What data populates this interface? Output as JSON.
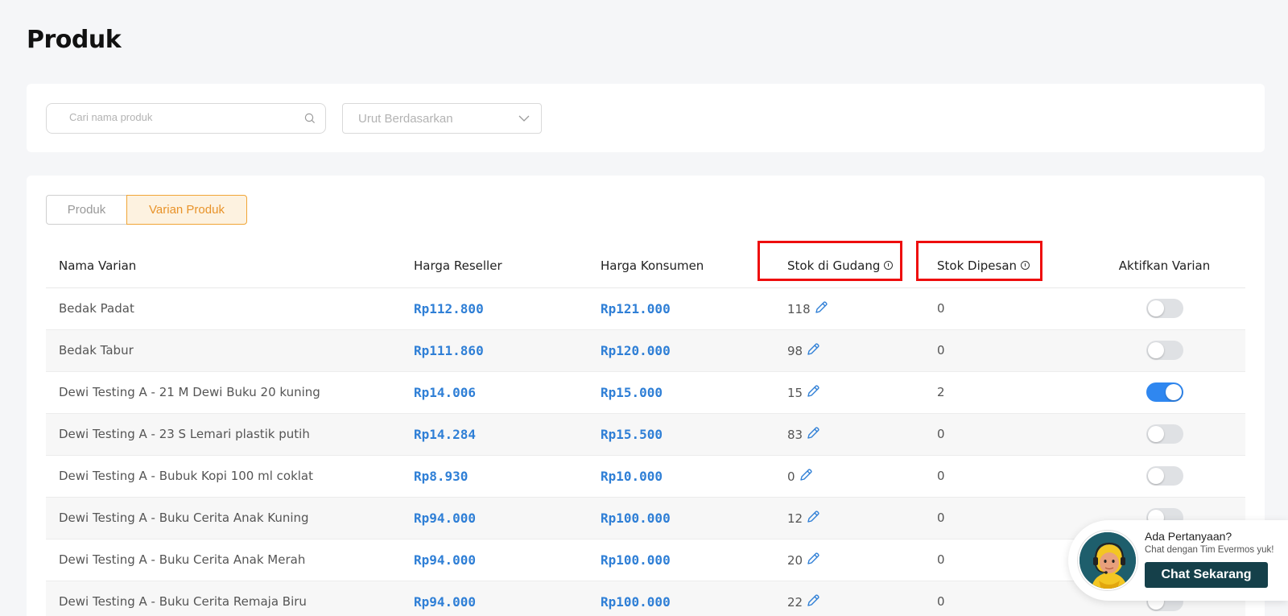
{
  "page": {
    "title": "Produk"
  },
  "filters": {
    "search_placeholder": "Cari nama produk",
    "sort_label": "Urut Berdasarkan"
  },
  "tabs": [
    {
      "label": "Produk",
      "active": false
    },
    {
      "label": "Varian Produk",
      "active": true
    }
  ],
  "table": {
    "columns": [
      "Nama Varian",
      "Harga Reseller",
      "Harga Konsumen",
      "Stok di Gudang",
      "Stok Dipesan",
      "Aktifkan Varian"
    ],
    "highlighted_columns": [
      "Stok di Gudang",
      "Stok Dipesan"
    ],
    "rows": [
      {
        "name": "Bedak Padat",
        "reseller": "Rp112.800",
        "consumer": "Rp121.000",
        "stock": "118",
        "ordered": "0",
        "active": false
      },
      {
        "name": "Bedak Tabur",
        "reseller": "Rp111.860",
        "consumer": "Rp120.000",
        "stock": "98",
        "ordered": "0",
        "active": false
      },
      {
        "name": "Dewi Testing A - 21 M Dewi Buku 20 kuning",
        "reseller": "Rp14.006",
        "consumer": "Rp15.000",
        "stock": "15",
        "ordered": "2",
        "active": true
      },
      {
        "name": "Dewi Testing A - 23 S Lemari plastik putih",
        "reseller": "Rp14.284",
        "consumer": "Rp15.500",
        "stock": "83",
        "ordered": "0",
        "active": false
      },
      {
        "name": "Dewi Testing A - Bubuk Kopi 100 ml coklat",
        "reseller": "Rp8.930",
        "consumer": "Rp10.000",
        "stock": "0",
        "ordered": "0",
        "active": false
      },
      {
        "name": "Dewi Testing A - Buku Cerita Anak Kuning",
        "reseller": "Rp94.000",
        "consumer": "Rp100.000",
        "stock": "12",
        "ordered": "0",
        "active": false
      },
      {
        "name": "Dewi Testing A - Buku Cerita Anak Merah",
        "reseller": "Rp94.000",
        "consumer": "Rp100.000",
        "stock": "20",
        "ordered": "0",
        "active": false
      },
      {
        "name": "Dewi Testing A - Buku Cerita Remaja Biru",
        "reseller": "Rp94.000",
        "consumer": "Rp100.000",
        "stock": "22",
        "ordered": "0",
        "active": false
      }
    ]
  },
  "chat": {
    "title": "Ada Pertanyaan?",
    "subtitle": "Chat dengan Tim Evermos yuk!",
    "button": "Chat Sekarang"
  },
  "colors": {
    "accent_orange": "#e8932a",
    "price_blue": "#2f7fd6",
    "toggle_on": "#2f87f0",
    "highlight_red": "#ee0d0d",
    "chat_button": "#15404a"
  }
}
